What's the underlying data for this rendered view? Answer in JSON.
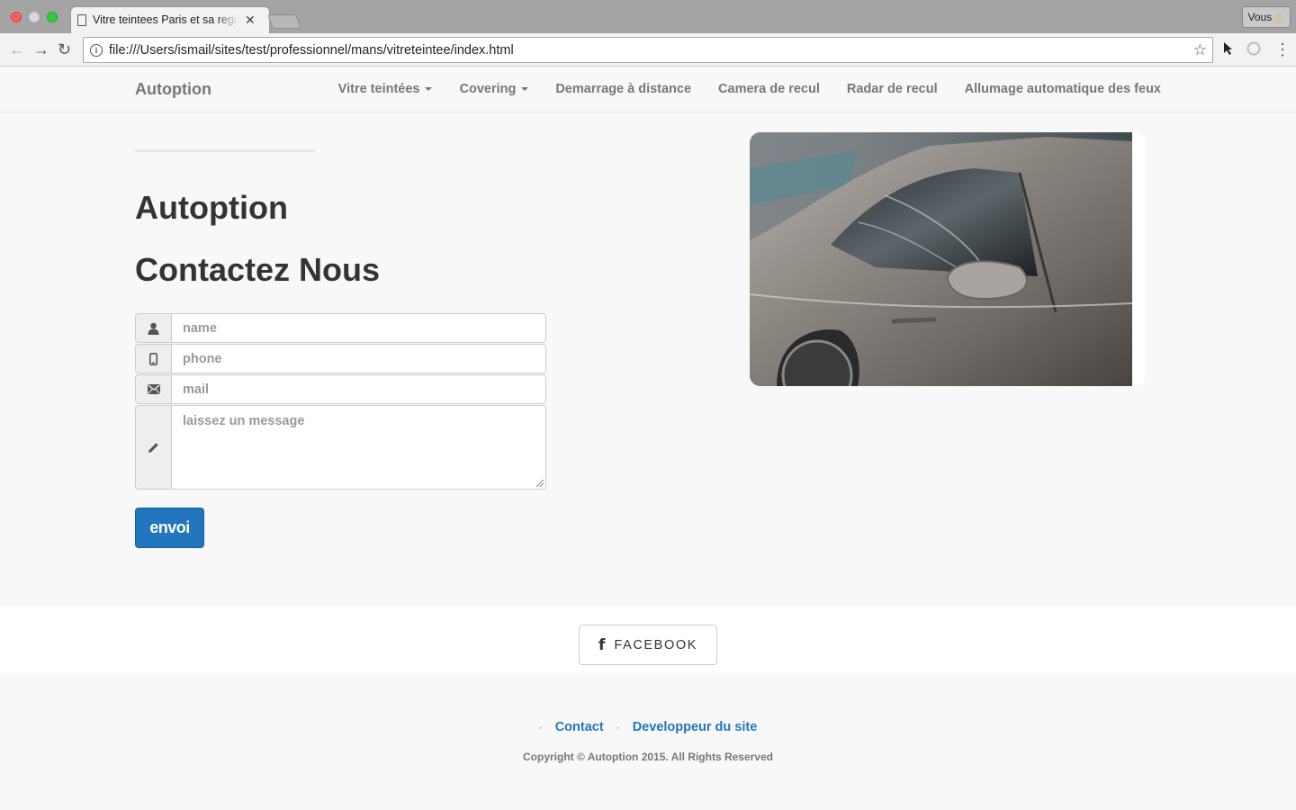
{
  "browser": {
    "tab_title": "Vitre teintees Paris et sa region",
    "tab_close": "✕",
    "profile_label": "Vous",
    "profile_warning": "⚠",
    "url": "file:///Users/ismail/sites/test/professionnel/mans/vitreteintee/index.html",
    "info_icon": "i",
    "back": "←",
    "forward": "→",
    "reload": "↻",
    "bookmark": "☆",
    "menu": "⋮"
  },
  "navbar": {
    "brand": "Autoption",
    "items": [
      {
        "label": "Vitre teintées",
        "dropdown": true
      },
      {
        "label": "Covering",
        "dropdown": true
      },
      {
        "label": "Demarrage à distance",
        "dropdown": false
      },
      {
        "label": "Camera de recul",
        "dropdown": false
      },
      {
        "label": "Radar de recul",
        "dropdown": false
      },
      {
        "label": "Allumage automatique des feux",
        "dropdown": false
      }
    ]
  },
  "main": {
    "heading_brand": "Autoption",
    "heading_contact": "Contactez Nous",
    "form": {
      "name_placeholder": "name",
      "phone_placeholder": "phone",
      "mail_placeholder": "mail",
      "message_placeholder": "laissez un message",
      "submit_label": "envoi"
    }
  },
  "social": {
    "facebook_icon": "f",
    "facebook_label": "FACEBOOK"
  },
  "footer": {
    "links": [
      "Contact",
      "Developpeur du site"
    ],
    "separator": "·",
    "copyright": "Copyright © Autoption 2015. All Rights Reserved"
  },
  "colors": {
    "accent": "#2276bd",
    "nav_text": "#777777",
    "page_bg": "#f8f8f8"
  }
}
